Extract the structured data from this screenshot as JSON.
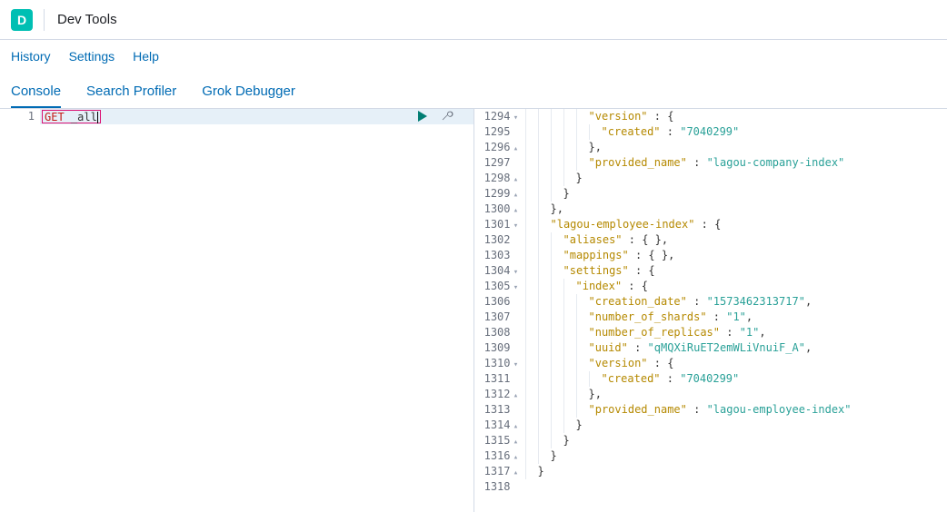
{
  "header": {
    "badge": "D",
    "title": "Dev Tools"
  },
  "subnav": {
    "history": "History",
    "settings": "Settings",
    "help": "Help"
  },
  "tabs": {
    "console": "Console",
    "search_profiler": "Search Profiler",
    "grok_debugger": "Grok Debugger"
  },
  "request": {
    "line_no": "1",
    "method": "GET",
    "path": "_all"
  },
  "response_lines": [
    {
      "no": "1294",
      "fold": "▾",
      "ind": 5,
      "tokens": [
        [
          "k",
          "\"version\""
        ],
        [
          "p",
          " : {"
        ]
      ]
    },
    {
      "no": "1295",
      "fold": "",
      "ind": 6,
      "tokens": [
        [
          "k",
          "\"created\""
        ],
        [
          "p",
          " : "
        ],
        [
          "s",
          "\"7040299\""
        ]
      ]
    },
    {
      "no": "1296",
      "fold": "▴",
      "ind": 5,
      "tokens": [
        [
          "p",
          "},"
        ]
      ]
    },
    {
      "no": "1297",
      "fold": "",
      "ind": 5,
      "tokens": [
        [
          "k",
          "\"provided_name\""
        ],
        [
          "p",
          " : "
        ],
        [
          "s",
          "\"lagou-company-index\""
        ]
      ]
    },
    {
      "no": "1298",
      "fold": "▴",
      "ind": 4,
      "tokens": [
        [
          "p",
          "}"
        ]
      ]
    },
    {
      "no": "1299",
      "fold": "▴",
      "ind": 3,
      "tokens": [
        [
          "p",
          "}"
        ]
      ]
    },
    {
      "no": "1300",
      "fold": "▴",
      "ind": 2,
      "tokens": [
        [
          "p",
          "},"
        ]
      ]
    },
    {
      "no": "1301",
      "fold": "▾",
      "ind": 2,
      "tokens": [
        [
          "k",
          "\"lagou-employee-index\""
        ],
        [
          "p",
          " : {"
        ]
      ]
    },
    {
      "no": "1302",
      "fold": "",
      "ind": 3,
      "tokens": [
        [
          "k",
          "\"aliases\""
        ],
        [
          "p",
          " : { },"
        ]
      ]
    },
    {
      "no": "1303",
      "fold": "",
      "ind": 3,
      "tokens": [
        [
          "k",
          "\"mappings\""
        ],
        [
          "p",
          " : { },"
        ]
      ]
    },
    {
      "no": "1304",
      "fold": "▾",
      "ind": 3,
      "tokens": [
        [
          "k",
          "\"settings\""
        ],
        [
          "p",
          " : {"
        ]
      ]
    },
    {
      "no": "1305",
      "fold": "▾",
      "ind": 4,
      "tokens": [
        [
          "k",
          "\"index\""
        ],
        [
          "p",
          " : {"
        ]
      ]
    },
    {
      "no": "1306",
      "fold": "",
      "ind": 5,
      "tokens": [
        [
          "k",
          "\"creation_date\""
        ],
        [
          "p",
          " : "
        ],
        [
          "s",
          "\"1573462313717\""
        ],
        [
          "p",
          ","
        ]
      ]
    },
    {
      "no": "1307",
      "fold": "",
      "ind": 5,
      "tokens": [
        [
          "k",
          "\"number_of_shards\""
        ],
        [
          "p",
          " : "
        ],
        [
          "s",
          "\"1\""
        ],
        [
          "p",
          ","
        ]
      ]
    },
    {
      "no": "1308",
      "fold": "",
      "ind": 5,
      "tokens": [
        [
          "k",
          "\"number_of_replicas\""
        ],
        [
          "p",
          " : "
        ],
        [
          "s",
          "\"1\""
        ],
        [
          "p",
          ","
        ]
      ]
    },
    {
      "no": "1309",
      "fold": "",
      "ind": 5,
      "tokens": [
        [
          "k",
          "\"uuid\""
        ],
        [
          "p",
          " : "
        ],
        [
          "s",
          "\"qMQXiRuET2emWLiVnuiF_A\""
        ],
        [
          "p",
          ","
        ]
      ]
    },
    {
      "no": "1310",
      "fold": "▾",
      "ind": 5,
      "tokens": [
        [
          "k",
          "\"version\""
        ],
        [
          "p",
          " : {"
        ]
      ]
    },
    {
      "no": "1311",
      "fold": "",
      "ind": 6,
      "tokens": [
        [
          "k",
          "\"created\""
        ],
        [
          "p",
          " : "
        ],
        [
          "s",
          "\"7040299\""
        ]
      ]
    },
    {
      "no": "1312",
      "fold": "▴",
      "ind": 5,
      "tokens": [
        [
          "p",
          "},"
        ]
      ]
    },
    {
      "no": "1313",
      "fold": "",
      "ind": 5,
      "tokens": [
        [
          "k",
          "\"provided_name\""
        ],
        [
          "p",
          " : "
        ],
        [
          "s",
          "\"lagou-employee-index\""
        ]
      ]
    },
    {
      "no": "1314",
      "fold": "▴",
      "ind": 4,
      "tokens": [
        [
          "p",
          "}"
        ]
      ]
    },
    {
      "no": "1315",
      "fold": "▴",
      "ind": 3,
      "tokens": [
        [
          "p",
          "}"
        ]
      ]
    },
    {
      "no": "1316",
      "fold": "▴",
      "ind": 2,
      "tokens": [
        [
          "p",
          "}"
        ]
      ]
    },
    {
      "no": "1317",
      "fold": "▴",
      "ind": 1,
      "tokens": [
        [
          "p",
          "}"
        ]
      ]
    },
    {
      "no": "1318",
      "fold": "",
      "ind": 0,
      "tokens": []
    }
  ]
}
